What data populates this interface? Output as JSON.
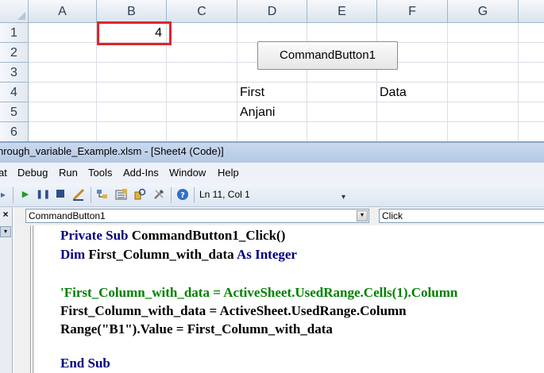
{
  "sheet": {
    "columns": [
      "A",
      "B",
      "C",
      "D",
      "E",
      "F",
      "G"
    ],
    "rows": [
      "1",
      "2",
      "3",
      "4",
      "5",
      "6"
    ],
    "cells": {
      "B1": "4",
      "D4": "First",
      "F4": "Data",
      "D5": "Anjani"
    },
    "button_label": "CommandButton1",
    "highlight_color": "#e0252c"
  },
  "vbe": {
    "title": "hrough_variable_Example.xlsm - [Sheet4 (Code)]",
    "menu": [
      "at",
      "Debug",
      "Run",
      "Tools",
      "Add-Ins",
      "Window",
      "Help"
    ],
    "toolbar_icons": [
      "run-icon",
      "break-icon",
      "reset-icon",
      "design-mode-icon",
      "project-explorer-icon",
      "properties-icon",
      "object-browser-icon",
      "toolbox-icon",
      "help-icon"
    ],
    "cursor_position": "Ln 11, Col 1",
    "object_combo": "CommandButton1",
    "procedure_combo": "Click",
    "close_glyph": "×",
    "code": {
      "l1_kw": "Private Sub",
      "l1_rest": " CommandButton1_Click()",
      "l2_kw1": "Dim",
      "l2_mid": " First_Column_with_data ",
      "l2_kw2": "As Integer",
      "l3_comment": "'First_Column_with_data = ActiveSheet.UsedRange.Cells(1).Column",
      "l4": "First_Column_with_data = ActiveSheet.UsedRange.Column",
      "l5": "Range(\"B1\").Value = First_Column_with_data",
      "l6_kw": "End Sub"
    },
    "colors": {
      "keyword": "#00007f",
      "comment": "#008000"
    }
  }
}
